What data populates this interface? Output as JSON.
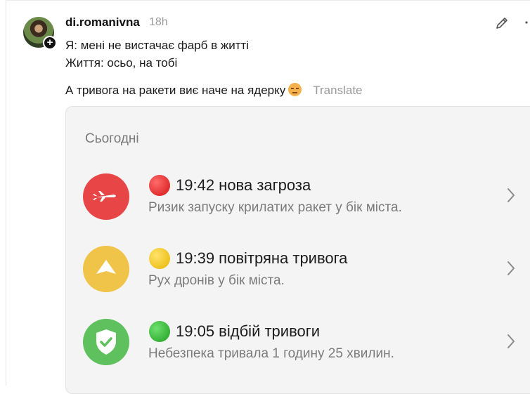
{
  "post": {
    "username": "di.romanivna",
    "time": "18h",
    "line1": "Я: мені не вистачає фарб в житті",
    "line2": "Життя: осьо, на тобі",
    "line3": "А тривога на ракети виє наче на ядерку",
    "translate": "Translate"
  },
  "card": {
    "heading": "Сьогодні",
    "alerts": [
      {
        "title": "19:42 нова загроза",
        "subtitle": "Ризик запуску крилатих ракет у бік міста.",
        "icon": "missile-icon",
        "color": "#e84646",
        "dot_color": "#e02020"
      },
      {
        "title": "19:39 повітряна тривога",
        "subtitle": "Рух дронів у бік міста.",
        "icon": "drone-icon",
        "color": "#f0c448",
        "dot_color": "#f5c518"
      },
      {
        "title": "19:05 відбій тривоги",
        "subtitle": "Небезпека тривала 1 годину 25 хвилин.",
        "icon": "shield-check-icon",
        "color": "#5ec15d",
        "dot_color": "#2fb12f"
      }
    ]
  }
}
